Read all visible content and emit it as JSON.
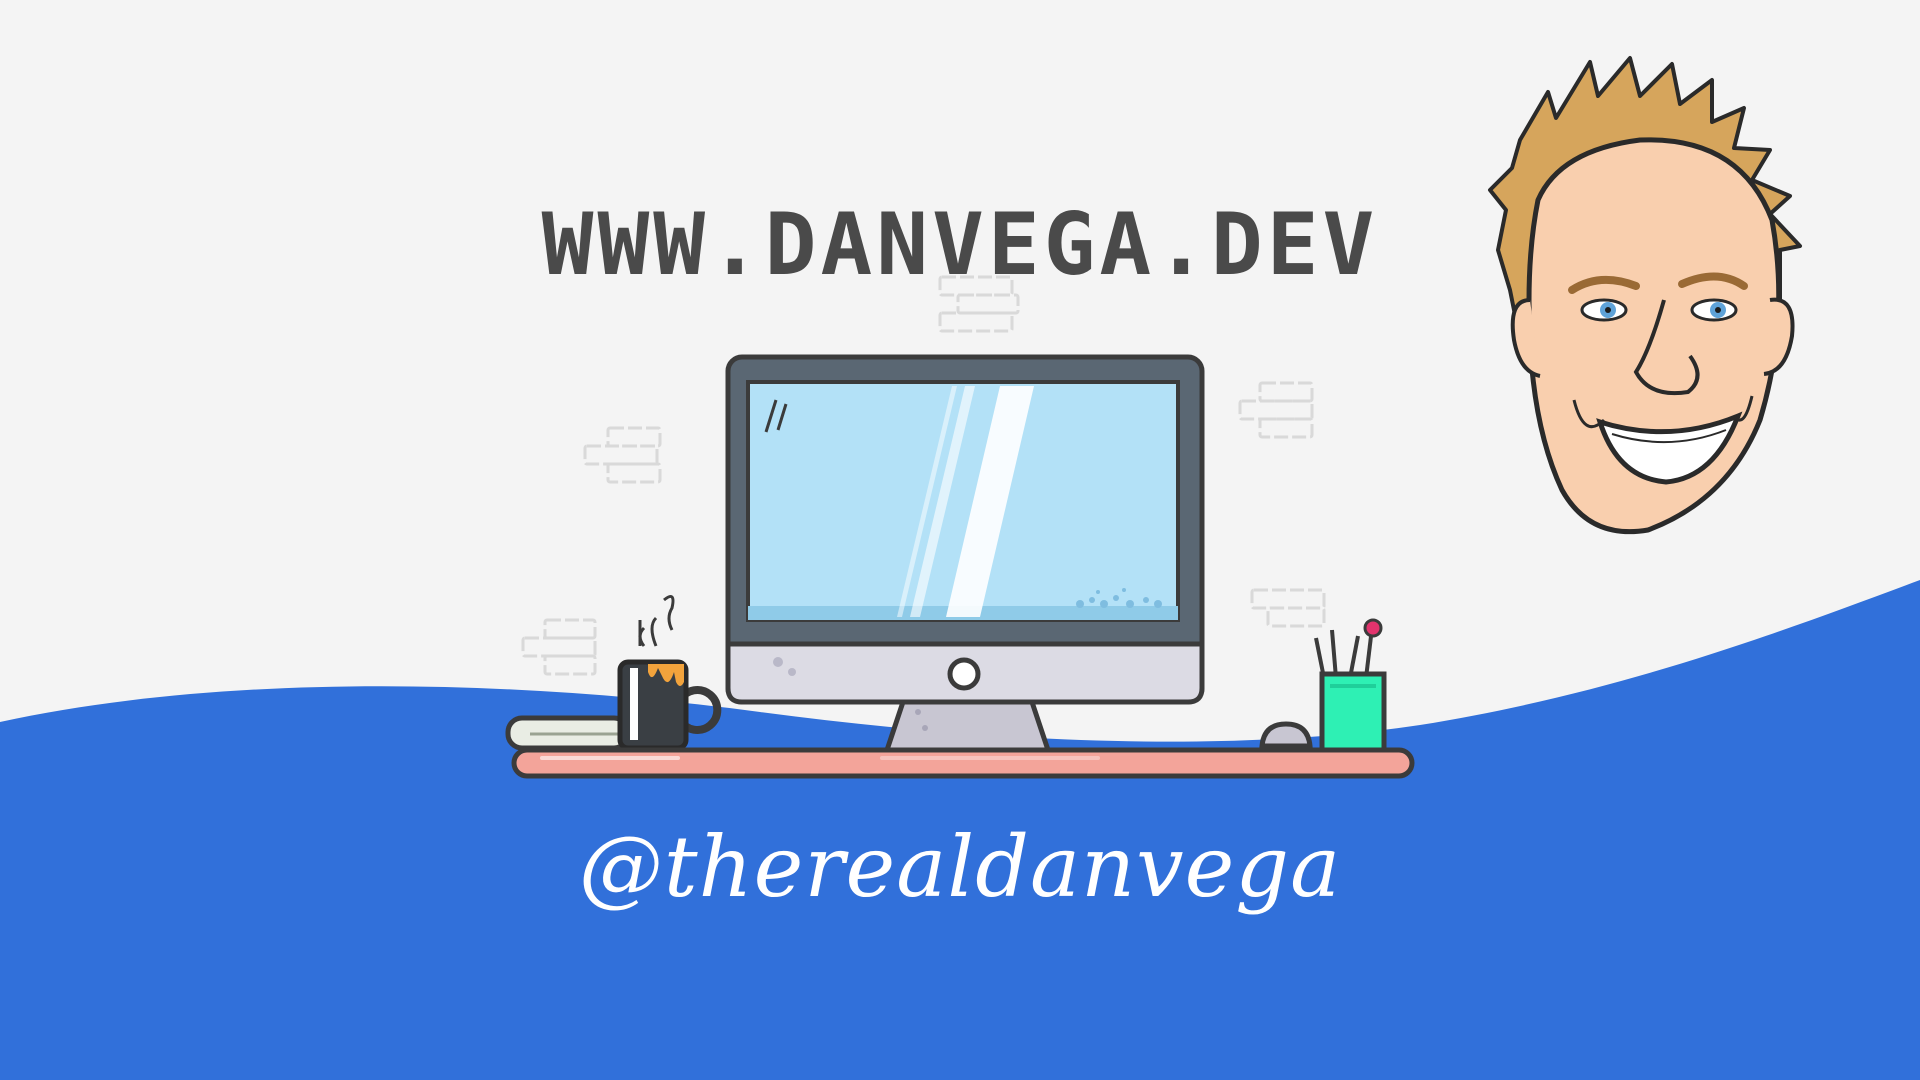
{
  "site": {
    "url": "WWW.DANVEGA.DEV"
  },
  "social": {
    "handle": "@therealdanvega"
  },
  "colors": {
    "background": "#f4f4f4",
    "wave": "#3170da",
    "title_text": "#4a4a4a",
    "screen": "#b3e1f7",
    "desk": "#f3a49a",
    "pen_cup": "#2ef0b4"
  },
  "illustration": {
    "avatar": "caricature-portrait",
    "desk_items": [
      "books",
      "coffee-mug",
      "monitor",
      "mouse",
      "pen-cup"
    ]
  }
}
